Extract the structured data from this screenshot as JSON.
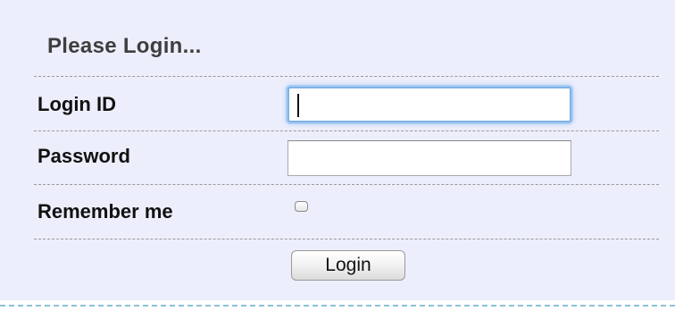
{
  "form": {
    "title": "Please Login...",
    "login_id": {
      "label": "Login ID",
      "value": "",
      "placeholder": ""
    },
    "password": {
      "label": "Password",
      "value": "",
      "placeholder": ""
    },
    "remember": {
      "label": "Remember me",
      "checked": false
    },
    "submit_label": "Login"
  },
  "colors": {
    "panel_background": "#edeefc",
    "focus_ring": "#7fb2e6",
    "bottom_border": "#8cc1da"
  }
}
